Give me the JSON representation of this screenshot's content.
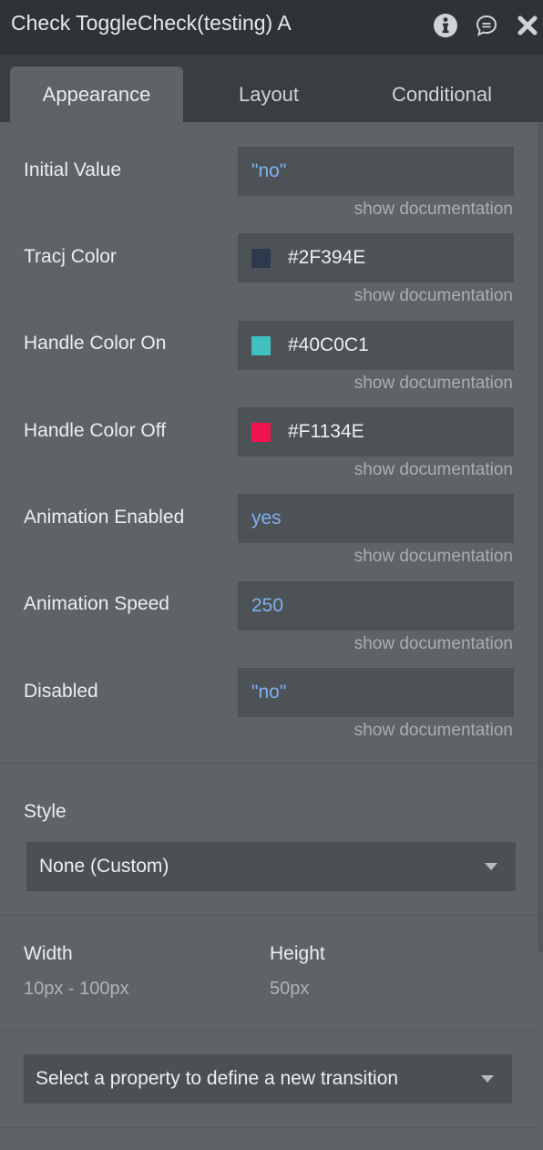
{
  "header": {
    "title": "Check ToggleCheck(testing) A",
    "icons": [
      "info-icon",
      "chat-icon",
      "close-icon"
    ]
  },
  "tabs": [
    {
      "label": "Appearance",
      "active": true
    },
    {
      "label": "Layout",
      "active": false
    },
    {
      "label": "Conditional",
      "active": false
    }
  ],
  "properties": [
    {
      "label": "Initial Value",
      "value": "\"no\"",
      "doc": "show documentation"
    },
    {
      "label": "Tracj Color",
      "value": "#2F394E",
      "swatch": "#2F394E",
      "doc": "show documentation"
    },
    {
      "label": "Handle Color On",
      "value": "#40C0C1",
      "swatch": "#40C0C1",
      "doc": "show documentation"
    },
    {
      "label": "Handle Color Off",
      "value": "#F1134E",
      "swatch": "#F1134E",
      "doc": "show documentation"
    },
    {
      "label": "Animation Enabled",
      "value": "yes",
      "doc": "show documentation"
    },
    {
      "label": "Animation Speed",
      "value": "250",
      "doc": "show documentation"
    },
    {
      "label": "Disabled",
      "value": "\"no\"",
      "doc": "show documentation"
    }
  ],
  "style": {
    "label": "Style",
    "selected": "None (Custom)"
  },
  "dimensions": {
    "width_label": "Width",
    "width_value": "10px - 100px",
    "height_label": "Height",
    "height_value": "50px"
  },
  "transition": {
    "placeholder": "Select a property to define a new transition"
  },
  "colors": {
    "title_bar": "#2f3337",
    "panel_bg": "#5e6367",
    "field_bg": "#4d5256",
    "dynamic_value": "#7fb0ee"
  }
}
